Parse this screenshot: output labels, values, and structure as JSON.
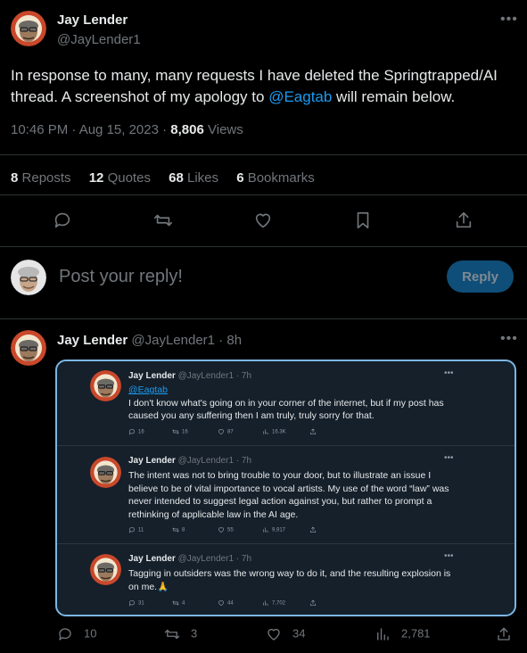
{
  "main_tweet": {
    "author_name": "Jay Lender",
    "author_handle": "@JayLender1",
    "text_before_mention": "In response to many, many requests I have deleted the Springtrapped/AI thread. A screenshot of my apology to ",
    "mention": "@Eagtab",
    "text_after_mention": " will remain below.",
    "timestamp": "10:46 PM · Aug 15, 2023 · ",
    "views_count": "8,806",
    "views_label": " Views",
    "stats": {
      "reposts_count": "8",
      "reposts_label": "Reposts",
      "quotes_count": "12",
      "quotes_label": "Quotes",
      "likes_count": "68",
      "likes_label": "Likes",
      "bookmarks_count": "6",
      "bookmarks_label": "Bookmarks"
    }
  },
  "reply_composer": {
    "placeholder": "Post your reply!",
    "button_label": "Reply"
  },
  "second_tweet": {
    "author_name": "Jay Lender",
    "author_handle": "@JayLender1",
    "time": "· 8h",
    "actions": {
      "replies": "10",
      "reposts": "3",
      "likes": "34",
      "views": "2,781"
    }
  },
  "screenshot_card": {
    "tweets": [
      {
        "author_name": "Jay Lender",
        "author_handle": "@JayLender1",
        "time": "· 7h",
        "mention": "@Eagtab",
        "text": "I don't know what's going on in your corner of the internet, but if my post has caused you any suffering then I am truly, truly sorry for that.",
        "replies": "16",
        "reposts": "16",
        "likes": "87",
        "views": "16.3K"
      },
      {
        "author_name": "Jay Lender",
        "author_handle": "@JayLender1",
        "time": "· 7h",
        "text": "The intent was not to bring trouble to your door, but to illustrate an issue I believe to be of vital importance to vocal artists. My use of the word “law” was never intended to suggest legal action against you, but rather to prompt a rethinking of applicable law in the AI age.",
        "replies": "11",
        "reposts": "8",
        "likes": "55",
        "views": "9,917"
      },
      {
        "author_name": "Jay Lender",
        "author_handle": "@JayLender1",
        "time": "· 7h",
        "text": "Tagging in outsiders was the wrong way to do it, and the resulting explosion is on me.🙏",
        "replies": "31",
        "reposts": "4",
        "likes": "44",
        "views": "7,702"
      }
    ]
  },
  "avatar_text": {
    "top": "ASK",
    "bottom": "MY STYLIST"
  },
  "colors": {
    "background": "#000000",
    "text": "#e7e9ea",
    "muted": "#71767b",
    "link": "#1d9bf0",
    "reply_button": "#0f4e78",
    "card_background": "#15202b",
    "card_border": "#7bb6e5"
  },
  "icons": {
    "more": "more-horizontal-icon",
    "reply": "comment-icon",
    "repost": "repost-icon",
    "like": "heart-icon",
    "bookmark": "bookmark-icon",
    "share": "share-icon",
    "views": "bar-chart-icon"
  }
}
